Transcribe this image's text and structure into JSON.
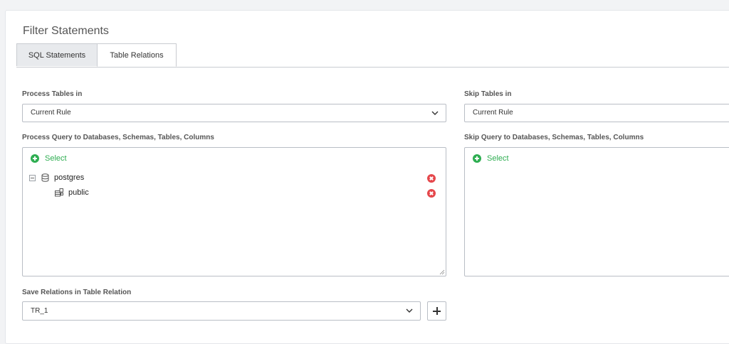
{
  "page": {
    "title": "Filter Statements"
  },
  "tabs": [
    {
      "label": "SQL Statements",
      "active": false
    },
    {
      "label": "Table Relations",
      "active": true
    }
  ],
  "process": {
    "tables_label": "Process Tables in",
    "tables_value": "Current Rule",
    "query_label": "Process Query to Databases, Schemas, Tables, Columns",
    "select_label": "Select",
    "tree": [
      {
        "name": "postgres",
        "icon": "database-icon",
        "level": 0
      },
      {
        "name": "public",
        "icon": "schema-icon",
        "level": 1
      }
    ]
  },
  "skip": {
    "tables_label": "Skip Tables in",
    "tables_value": "Current Rule",
    "query_label": "Skip Query to Databases, Schemas, Tables, Columns",
    "select_label": "Select"
  },
  "save": {
    "label": "Save Relations in Table Relation",
    "value": "TR_1"
  },
  "colors": {
    "accent_green": "#2fae52",
    "remove_red": "#e5474b"
  }
}
